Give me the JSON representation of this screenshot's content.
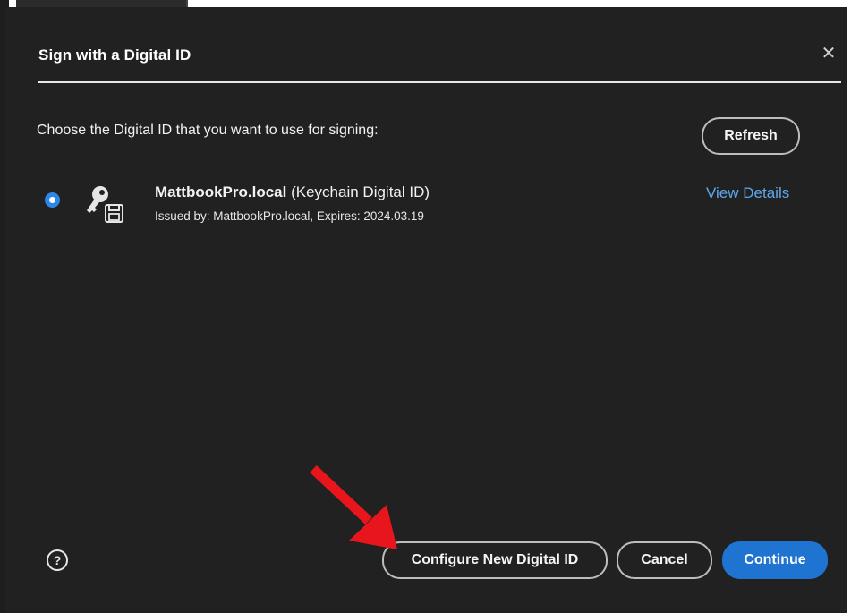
{
  "dialog": {
    "title": "Sign with a Digital ID",
    "close_icon": "close-icon",
    "prompt": "Choose the Digital ID that you want to use for signing:",
    "refresh_label": "Refresh",
    "digital_ids": [
      {
        "name": "MattbookPro.local",
        "type": "(Keychain Digital ID)",
        "issued": "Issued by: MattbookPro.local, Expires: 2024.03.19",
        "selected": true,
        "icon": "key-lock-icon",
        "view_details_label": "View Details"
      }
    ],
    "help_icon": "help-icon",
    "help_glyph": "?",
    "configure_label": "Configure New Digital ID",
    "cancel_label": "Cancel",
    "continue_label": "Continue"
  },
  "colors": {
    "dialog_bg": "#212121",
    "accent": "#1f74d1",
    "link": "#5ea6ec",
    "annotation_arrow": "#e8161c"
  }
}
